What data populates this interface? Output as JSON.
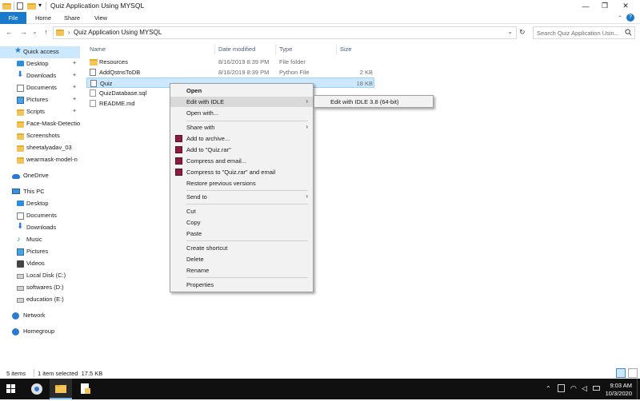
{
  "window": {
    "title": "Quiz Application Using MYSQL",
    "controls": {
      "minimize": "—",
      "maximize": "❐",
      "close": "✕"
    }
  },
  "ribbon": {
    "tabs": [
      "File",
      "Home",
      "Share",
      "View"
    ],
    "collapse": "⌃",
    "help": "?"
  },
  "address": {
    "path": "Quiz Application Using MYSQL",
    "separator": "›",
    "dropdown": "⌄",
    "refresh": "↻",
    "back": "←",
    "forward": "→",
    "recent": "⌄",
    "up": "↑"
  },
  "search": {
    "placeholder": "Search Quiz Application Usin..."
  },
  "navpane": {
    "quick_access": "Quick access",
    "quick_items": [
      "Desktop",
      "Downloads",
      "Documents",
      "Pictures",
      "Scripts",
      "Face-Mask-Detectio",
      "Screenshots",
      "sheetalyadav_03",
      "wearmask-model-n"
    ],
    "onedrive": "OneDrive",
    "this_pc": "This PC",
    "pc_items": [
      "Desktop",
      "Documents",
      "Downloads",
      "Music",
      "Pictures",
      "Videos",
      "Local Disk (C:)",
      "softwares (D:)",
      "education (E:)"
    ],
    "network": "Network",
    "homegroup": "Homegroup"
  },
  "columns": {
    "name": "Name",
    "date": "Date modified",
    "type": "Type",
    "size": "Size"
  },
  "files": [
    {
      "name": "Resources",
      "date": "8/16/2019 8:39 PM",
      "type": "File folder",
      "size": ""
    },
    {
      "name": "AddQstnsToDB",
      "date": "8/16/2019 8:39 PM",
      "type": "Python File",
      "size": "2 KB"
    },
    {
      "name": "Quiz",
      "date": "",
      "type": "",
      "size": "18 KB"
    },
    {
      "name": "QuizDatabase.sql",
      "date": "",
      "type": "",
      "size": ""
    },
    {
      "name": "README.md",
      "date": "",
      "type": "",
      "size": ""
    }
  ],
  "context_menu": {
    "open": "Open",
    "edit_with_idle": "Edit with IDLE",
    "open_with": "Open with...",
    "share_with": "Share with",
    "add_to_archive": "Add to archive...",
    "add_to_rar": "Add to \"Quiz.rar\"",
    "compress_email": "Compress and email...",
    "compress_rar_email": "Compress to \"Quiz.rar\" and email",
    "restore": "Restore previous versions",
    "send_to": "Send to",
    "cut": "Cut",
    "copy": "Copy",
    "paste": "Paste",
    "create_shortcut": "Create shortcut",
    "delete": "Delete",
    "rename": "Rename",
    "properties": "Properties",
    "arrow": "›"
  },
  "submenu": {
    "idle": "Edit with IDLE 3.8 (64-bit)"
  },
  "status": {
    "items": "5 items",
    "selected": "1 item selected  17.5 KB"
  },
  "taskbar": {
    "time": "9:03 AM",
    "date": "10/3/2020"
  }
}
